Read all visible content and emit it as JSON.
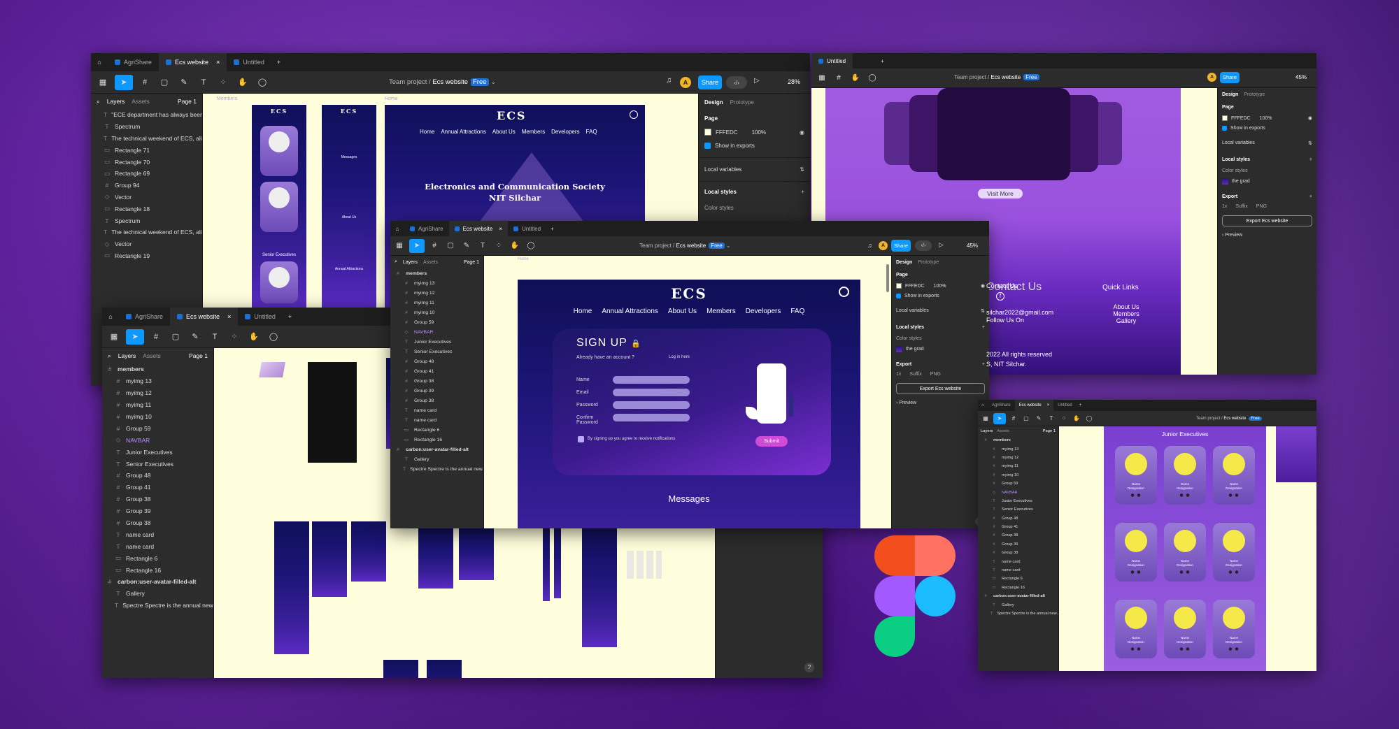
{
  "tabs": {
    "agri": "AgriShare",
    "ecs": "Ecs website",
    "untitled": "Untitled",
    "plus": "+"
  },
  "crumb": {
    "team": "Team project",
    "sep": "/",
    "file": "Ecs website",
    "plan": "Free"
  },
  "share": "Share",
  "user_initial": "A",
  "zoom": {
    "w1": "28%",
    "w2": "45%",
    "w3": "45%"
  },
  "panel": {
    "layers": "Layers",
    "assets": "Assets",
    "page": "Page 1"
  },
  "right": {
    "design": "Design",
    "prototype": "Prototype",
    "page": "Page",
    "fill": "FFFEDC",
    "opacity": "100%",
    "show_exports": "Show in exports",
    "local_vars": "Local variables",
    "local_styles": "Local styles",
    "color_styles": "Color styles",
    "grad": "the grad",
    "export": "Export",
    "scale": "1x",
    "suffix": "Suffix",
    "format": "PNG",
    "export_btn": "Export Ecs website",
    "preview": "Preview",
    "help": "?"
  },
  "layers_w1": [
    "\"ECE department has always been...",
    "Spectrum",
    "The technical weekend of ECS, ali...",
    "Rectangle 71",
    "Rectangle 70",
    "Rectangle 69",
    "Group 94",
    "Vector",
    "Rectangle 18",
    "Spectrum",
    "The technical weekend of ECS, ali...",
    "Vector",
    "Rectangle 19"
  ],
  "layers_w2": [
    "members",
    "myimg 13",
    "myimg 12",
    "myimg 11",
    "myimg 10",
    "Group 59",
    "NAVBAR",
    "Junior Executives",
    "Senior Executives",
    "Group 48",
    "Group 41",
    "Group 38",
    "Group 39",
    "Group 38",
    "name card",
    "name card",
    "Rectangle 6",
    "Rectangle 16",
    "carbon:user-avatar-filled-alt",
    "Gallery",
    "Spectre Spectre is the annual new..."
  ],
  "layers_w3": [
    "members",
    "myimg 13",
    "myimg 12",
    "myimg 11",
    "myimg 10",
    "Group 59",
    "NAVBAR",
    "Junior Executives",
    "Senior Executives",
    "Group 48",
    "Group 41",
    "Group 38",
    "Group 39",
    "Group 38",
    "name card",
    "name card",
    "Rectangle 6",
    "Rectangle 16",
    "carbon:user-avatar-filled-alt",
    "Gallery",
    "Spectre Spectre is the annual new..."
  ],
  "layers_w5": [
    "members",
    "myimg 13",
    "myimg 12",
    "myimg 11",
    "myimg 10",
    "Group 59",
    "NAVBAR",
    "Junior Executives",
    "Senior Executives",
    "Group 48",
    "Group 41",
    "Group 38",
    "Group 39",
    "Group 38",
    "name card",
    "name card",
    "Rectangle 6",
    "Rectangle 16",
    "carbon:user-avatar-filled-alt",
    "Gallery",
    "Spectre Spectre is the annual new..."
  ],
  "site": {
    "logo": "ECS",
    "nav": [
      "Home",
      "Annual Attractions",
      "About Us",
      "Members",
      "Developers",
      "FAQ"
    ],
    "hero1": "Electronics and Communication Society",
    "hero2": "NIT Silchar",
    "signup": "SIGN UP",
    "have_account": "Already have an account ?",
    "login": "Log in here",
    "fields": [
      "Name",
      "Email",
      "Password",
      "Confirm Password"
    ],
    "terms": "By signing up you agree to receive notifications",
    "submit": "Submit",
    "messages": "Messages",
    "members_label": "Members",
    "frame_label": "Home"
  },
  "w4site": {
    "visit": "Visit More",
    "contact": "Contact Us",
    "email": "silchar2022@gmail.com",
    "follow": "Follow Us On",
    "quick": "Quick Links",
    "links": [
      "About Us",
      "Members",
      "Gallery"
    ],
    "copy1": "2022 All rights reserved",
    "copy2": "S, NIT Silchar."
  },
  "w5site": {
    "title": "Junior Executives",
    "name": "Name",
    "desig": "Designation"
  },
  "mock": {
    "messages": "Messages",
    "senior": "Senior Executives",
    "about": "About Us",
    "annual": "Annual Attractions",
    "name": "Name",
    "desig": "Designation"
  }
}
